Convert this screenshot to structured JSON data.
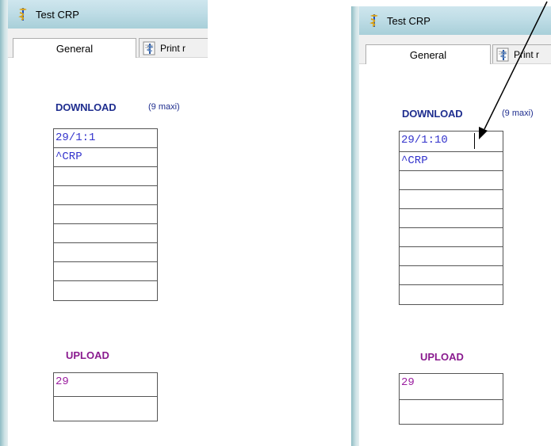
{
  "left_window": {
    "title": "Test CRP",
    "tabs": [
      {
        "label": "General"
      },
      {
        "label": "Print r"
      }
    ],
    "download": {
      "label": "DOWNLOAD",
      "note": "(9 maxi)",
      "cells": [
        "29/1:1",
        "^CRP",
        "",
        "",
        "",
        "",
        "",
        "",
        ""
      ]
    },
    "upload": {
      "label": "UPLOAD",
      "cells": [
        "29",
        ""
      ]
    }
  },
  "right_window": {
    "title": "Test CRP",
    "tabs": [
      {
        "label": "General"
      },
      {
        "label": "Print r"
      }
    ],
    "download": {
      "label": "DOWNLOAD",
      "note": "(9 maxi)",
      "cells": [
        "29/1:10",
        "^CRP",
        "",
        "",
        "",
        "",
        "",
        "",
        ""
      ]
    },
    "upload": {
      "label": "UPLOAD",
      "cells": [
        "29",
        ""
      ]
    }
  },
  "colors": {
    "download_text": "#3333cc",
    "upload_text": "#9b1ea0",
    "download_header": "#1f2e8f",
    "upload_header": "#8a1b8f"
  },
  "icons": {
    "app": "caduceus-icon",
    "print_tab": "print-document-icon"
  }
}
